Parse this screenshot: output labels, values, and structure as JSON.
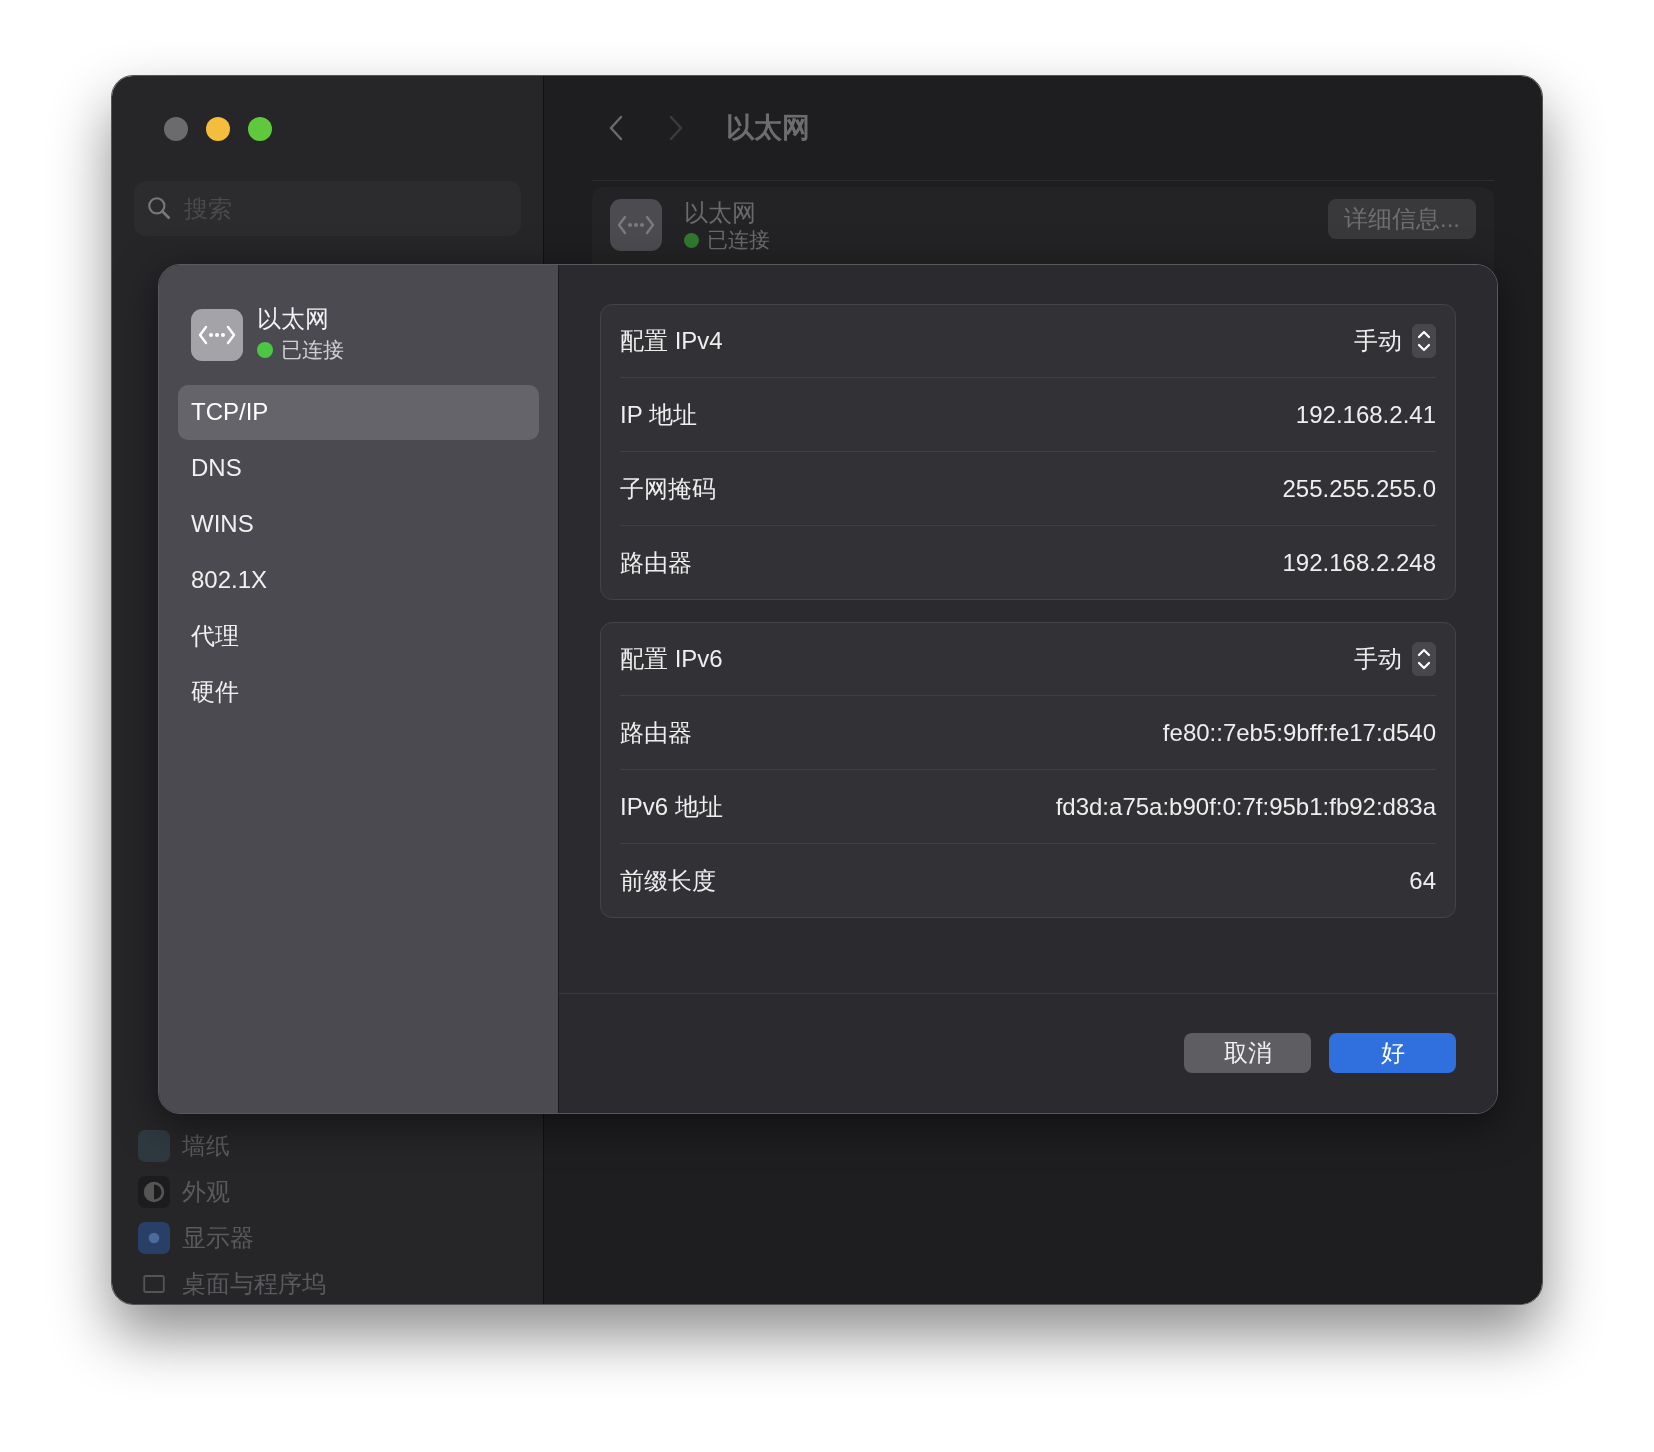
{
  "window": {
    "title": "以太网"
  },
  "sidebar": {
    "search": {
      "placeholder": "搜索"
    },
    "items": [
      {
        "kind": "wallpaper",
        "label": "墙纸"
      },
      {
        "kind": "appearance",
        "label": "外观"
      },
      {
        "kind": "display",
        "label": "显示器"
      },
      {
        "kind": "desktop",
        "label": "桌面与程序坞"
      }
    ]
  },
  "service_card": {
    "name": "以太网",
    "status": "已连接",
    "details_button": "详细信息..."
  },
  "dialog": {
    "service": {
      "name": "以太网",
      "status": "已连接"
    },
    "tabs": [
      {
        "label": "TCP/IP",
        "selected": true
      },
      {
        "label": "DNS",
        "selected": false
      },
      {
        "label": "WINS",
        "selected": false
      },
      {
        "label": "802.1X",
        "selected": false
      },
      {
        "label": "代理",
        "selected": false
      },
      {
        "label": "硬件",
        "selected": false
      }
    ],
    "groups": [
      {
        "rows": [
          {
            "kind": "popup",
            "label": "配置 IPv4",
            "value": "手动"
          },
          {
            "kind": "text",
            "label": "IP 地址",
            "value": "192.168.2.41"
          },
          {
            "kind": "text",
            "label": "子网掩码",
            "value": "255.255.255.0"
          },
          {
            "kind": "text",
            "label": "路由器",
            "value": "192.168.2.248"
          }
        ]
      },
      {
        "rows": [
          {
            "kind": "popup",
            "label": "配置 IPv6",
            "value": "手动"
          },
          {
            "kind": "text",
            "label": "路由器",
            "value": "fe80::7eb5:9bff:fe17:d540"
          },
          {
            "kind": "text",
            "label": "IPv6 地址",
            "value": "fd3d:a75a:b90f:0:7f:95b1:fb92:d83a"
          },
          {
            "kind": "text",
            "label": "前缀长度",
            "value": "64"
          }
        ]
      }
    ],
    "buttons": [
      {
        "kind": "secondary",
        "label": "取消"
      },
      {
        "kind": "primary",
        "label": "好"
      }
    ]
  }
}
